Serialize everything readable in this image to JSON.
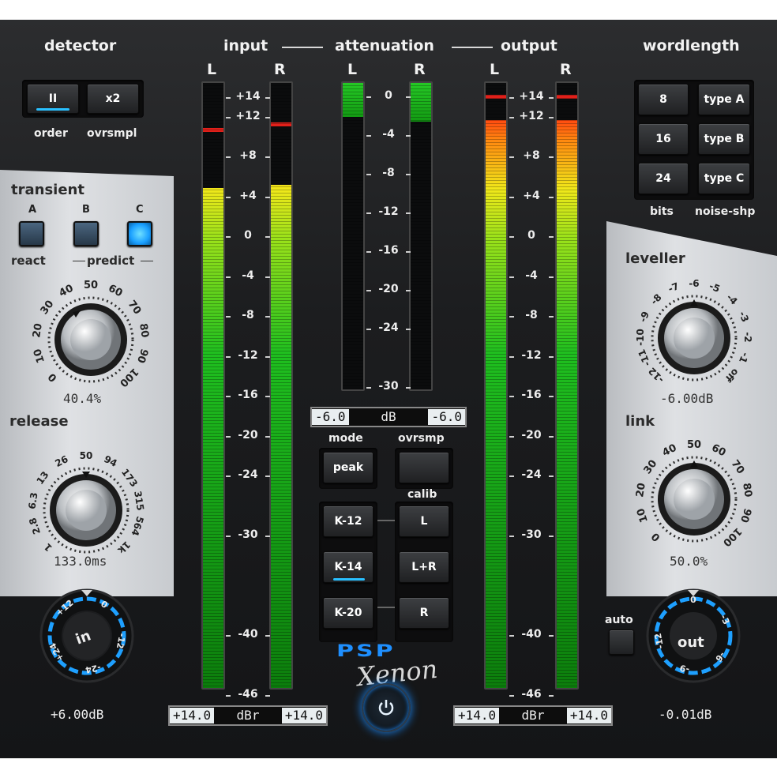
{
  "headers": {
    "detector": "detector",
    "input": "input",
    "attenuation": "attenuation",
    "output": "output",
    "wordlength": "wordlength"
  },
  "channels": {
    "left": "L",
    "right": "R"
  },
  "detector": {
    "order_button": "II",
    "ovrsmpl_button": "x2",
    "order_label": "order",
    "ovrsmpl_label": "ovrsmpl"
  },
  "transient": {
    "title": "transient",
    "buttons": [
      "A",
      "B",
      "C"
    ],
    "active_button": "C",
    "react_label": "react",
    "predict_label": "predict",
    "knob_scale": [
      "0",
      "10",
      "20",
      "30",
      "40",
      "50",
      "60",
      "70",
      "80",
      "90",
      "100"
    ],
    "value": "40.4%"
  },
  "release": {
    "title": "release",
    "knob_scale": [
      "1",
      "2.8",
      "6.3",
      "13",
      "26",
      "50",
      "94",
      "173",
      "315",
      "564",
      "1k"
    ],
    "value": "133.0ms"
  },
  "input_gain": {
    "label": "in",
    "scale": [
      "+12",
      "0",
      "-12",
      "-24",
      "+24"
    ],
    "value": "+6.00dB"
  },
  "output_gain": {
    "label": "out",
    "scale": [
      "0",
      "-3",
      "-6",
      "-9",
      "-12"
    ],
    "value": "-0.01dB",
    "auto_label": "auto"
  },
  "meter_scale": [
    "+14",
    "+12",
    "+8",
    "+4",
    "0",
    "-4",
    "-8",
    "-12",
    "-16",
    "-20",
    "-24",
    "-30",
    "-40",
    "-46"
  ],
  "atten_scale": [
    "0",
    "-4",
    "-8",
    "-12",
    "-16",
    "-20",
    "-24",
    "-30"
  ],
  "input_meter": {
    "left_level_db": 4.5,
    "right_level_db": 4.8,
    "left_peak_db": 10.5,
    "right_peak_db": 11.0
  },
  "output_meter": {
    "left_level_db": 11.3,
    "right_level_db": 11.3,
    "left_peak_db": 13.8,
    "right_peak_db": 13.8
  },
  "atten_meter": {
    "left_db": -2.5,
    "right_db": -3.0
  },
  "atten_readout": {
    "left": "-6.0",
    "unit": "dB",
    "right": "-6.0"
  },
  "input_readout": {
    "left": "+14.0",
    "unit": "dBr",
    "right": "+14.0"
  },
  "output_readout": {
    "left": "+14.0",
    "unit": "dBr",
    "right": "+14.0"
  },
  "mode": {
    "mode_label": "mode",
    "ovrsmp_label": "ovrsmp",
    "peak_button": "peak",
    "calib_label": "calib",
    "k_buttons": [
      "K-12",
      "K-14",
      "K-20"
    ],
    "active_k": "K-14",
    "channel_buttons": [
      "L",
      "L+R",
      "R"
    ]
  },
  "wordlength": {
    "bits": [
      "8",
      "16",
      "24"
    ],
    "noise": [
      "type A",
      "type B",
      "type C"
    ],
    "bits_label": "bits",
    "noise_label": "noise-shp"
  },
  "leveller": {
    "title": "leveller",
    "knob_scale": [
      "-12",
      "-11",
      "-10",
      "-9",
      "-8",
      "-7",
      "-6",
      "-5",
      "-4",
      "-3",
      "-2",
      "-1",
      "off"
    ],
    "value": "-6.00dB"
  },
  "link": {
    "title": "link",
    "knob_scale": [
      "0",
      "10",
      "20",
      "30",
      "40",
      "50",
      "60",
      "70",
      "80",
      "90",
      "100"
    ],
    "value": "50.0%"
  },
  "logo": {
    "brand": "PSP",
    "product": "Xenon"
  },
  "colors": {
    "accent": "#29a8ff",
    "meter_green": "#1fbf1f",
    "meter_red": "#ff1a10",
    "panel_silver": "#d6d8db"
  }
}
